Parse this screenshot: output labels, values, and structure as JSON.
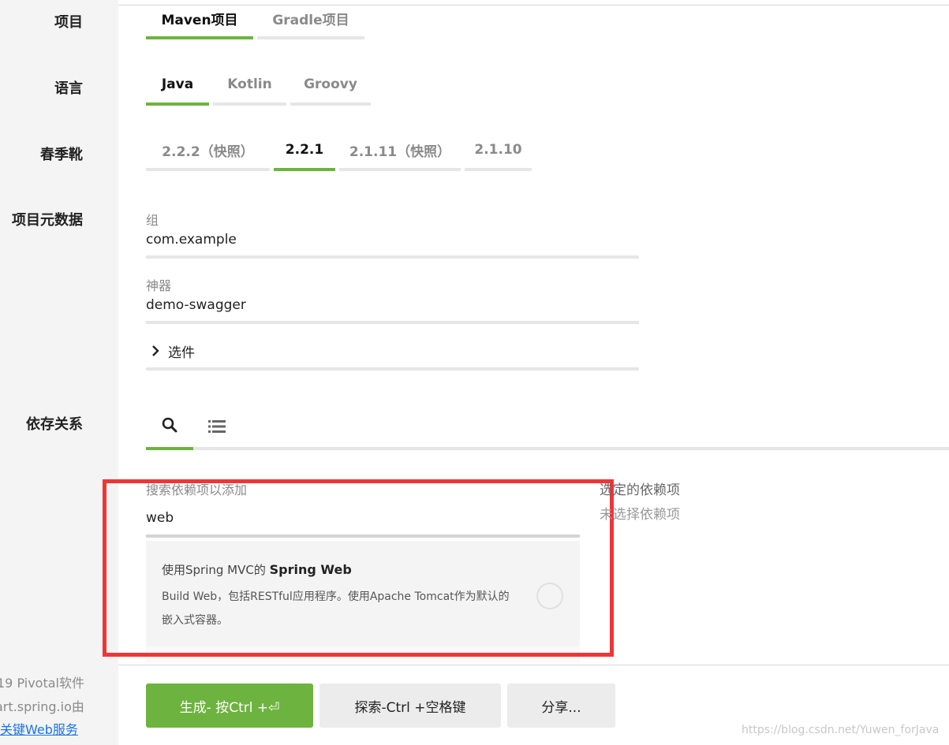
{
  "rows": {
    "project": "项目",
    "language": "语言",
    "spring_boot": "春季靴",
    "metadata": "项目元数据",
    "dependencies": "依存关系"
  },
  "project_tabs": [
    {
      "label": "Maven项目",
      "active": true
    },
    {
      "label": "Gradle项目",
      "active": false
    }
  ],
  "language_tabs": [
    {
      "label": "Java",
      "active": true
    },
    {
      "label": "Kotlin",
      "active": false
    },
    {
      "label": "Groovy",
      "active": false
    }
  ],
  "version_tabs": [
    {
      "label": "2.2.2（快照）",
      "active": false
    },
    {
      "label": "2.2.1",
      "active": true
    },
    {
      "label": "2.1.11（快照）",
      "active": false
    },
    {
      "label": "2.1.10",
      "active": false
    }
  ],
  "metadata": {
    "group_label": "组",
    "group_value": "com.example",
    "artifact_label": "神器",
    "artifact_value": "demo-swagger",
    "options_label": "选件"
  },
  "dependencies": {
    "search_tab_icon": "search-icon",
    "list_tab_icon": "list-icon",
    "search_label": "搜索依赖项以添加",
    "search_value": "web",
    "result": {
      "prefix": "使用Spring MVC的",
      "name": "Spring Web",
      "description": "Build Web，包括RESTful应用程序。使用Apache Tomcat作为默认的嵌入式容器。"
    },
    "selected_title": "选定的依赖项",
    "selected_empty": "未选择依赖项"
  },
  "buttons": {
    "generate": "生成- 按Ctrl +⏎",
    "explore": "探索-Ctrl +空格键",
    "share": "分享..."
  },
  "sidebar_footer": {
    "line1": "19 Pivotal软件",
    "line2": "art.spring.io由",
    "line3": "关键Web服务"
  },
  "watermark": "https://blog.csdn.net/Yuwen_forJava",
  "colors": {
    "accent": "#6db33f",
    "highlight": "#ee3538",
    "link": "#1a73e8"
  }
}
